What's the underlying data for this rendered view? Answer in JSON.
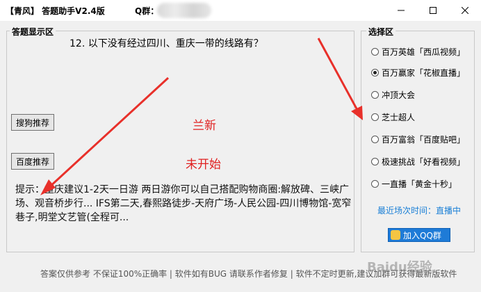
{
  "window": {
    "title": "【青风】 答题助手V2.4版",
    "qq_label": "Q群：",
    "controls": [
      "minimize-icon",
      "maximize-icon",
      "close-icon"
    ]
  },
  "answer_panel": {
    "title": "答题显示区",
    "question": "12.  以下没有经过四川、重庆一带的线路有？",
    "sogou_button": "搜狗推荐",
    "baidu_button": "百度推荐",
    "sogou_status": "兰新",
    "baidu_status": "未开始",
    "hint": "提示：重庆建议1-2天一日游  两日游你可以自己搭配购物商圈:解放碑、三峡广场、观音桥步行...  IFS第二天,春熙路徒步-天府广场-人民公园-四川博物馆-宽窄巷子,明堂文艺管(全程可..."
  },
  "options_panel": {
    "title": "选择区",
    "options": [
      {
        "label": "百万英雄「西瓜视频」",
        "checked": false
      },
      {
        "label": "百万赢家「花椒直播」",
        "checked": true
      },
      {
        "label": "冲顶大会",
        "checked": false
      },
      {
        "label": "芝士超人",
        "checked": false
      },
      {
        "label": "百万富翁「百度贴吧」",
        "checked": false
      },
      {
        "label": "极速挑战「好看视频」",
        "checked": false
      },
      {
        "label": "一直播「黄金十秒」",
        "checked": false
      }
    ],
    "recent_session": "最近场次时间：直播中",
    "join_qq_button": "加入QQ群"
  },
  "footer": "答案仅供参考 不保证100%正确率 | 软件如有BUG 请联系作者修复 | 软件不定时更新,建议加群可获得最新版软件",
  "watermark": "Baidu经验",
  "colors": {
    "status_red": "#e02020",
    "link_blue": "#1a7fd6",
    "arrow_red": "#e8302a"
  }
}
